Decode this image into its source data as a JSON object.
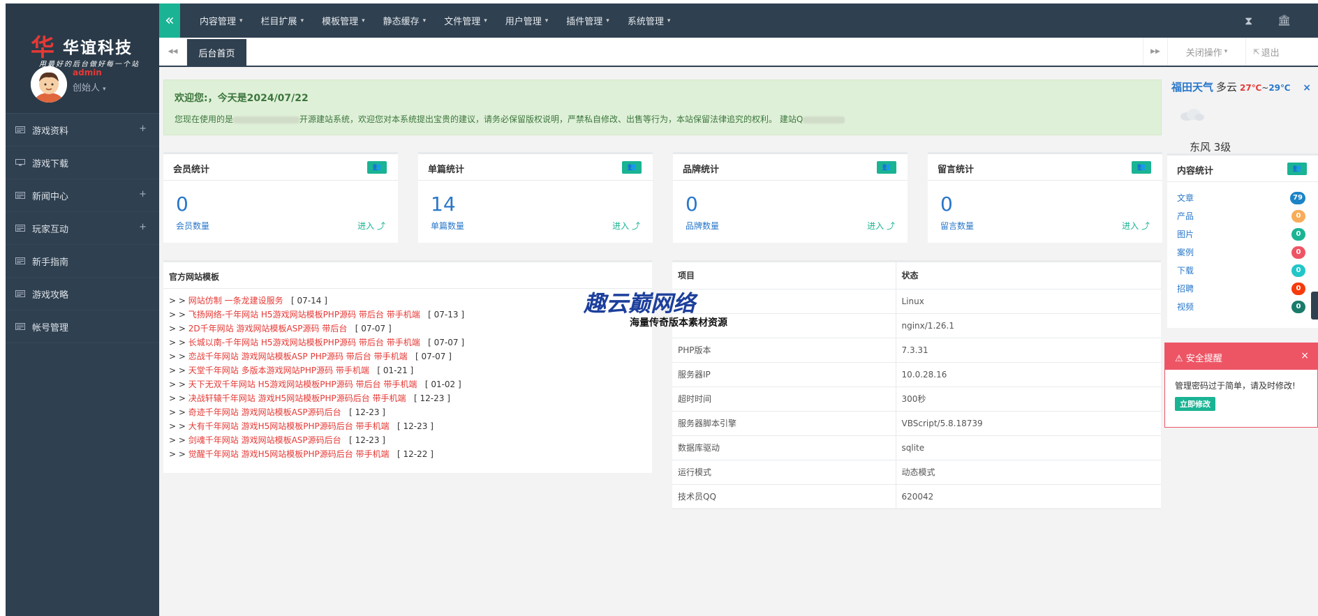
{
  "brand": {
    "mark": "华",
    "name": "华谊科技",
    "slogan": "用最好的后台做好每一个站"
  },
  "user": {
    "name": "admin",
    "role": "创始人"
  },
  "sidebar": {
    "items": [
      {
        "label": "游戏资料",
        "expandable": true,
        "icon": "list-icon"
      },
      {
        "label": "游戏下载",
        "expandable": false,
        "icon": "monitor-icon"
      },
      {
        "label": "新闻中心",
        "expandable": true,
        "icon": "list-icon"
      },
      {
        "label": "玩家互动",
        "expandable": true,
        "icon": "list-icon"
      },
      {
        "label": "新手指南",
        "expandable": false,
        "icon": "list-icon"
      },
      {
        "label": "游戏攻略",
        "expandable": false,
        "icon": "list-icon"
      },
      {
        "label": "帐号管理",
        "expandable": false,
        "icon": "list-icon"
      }
    ],
    "plus": "+"
  },
  "topnav": {
    "collapse_icon": "«",
    "menus": [
      "内容管理",
      "栏目扩展",
      "模板管理",
      "静态缓存",
      "文件管理",
      "用户管理",
      "插件管理",
      "系统管理"
    ],
    "caret": "▾",
    "hourglass": "⧗",
    "bank": "🏛"
  },
  "tabbar": {
    "back": "◀◀",
    "active": "后台首页",
    "forward": "▶▶",
    "close_ops": "关闭操作",
    "logout": "退出"
  },
  "welcome": {
    "title": "欢迎您:，今天是2024/07/22",
    "text_a": "您现在使用的是",
    "text_b": "开源建站系统，欢迎您对本系统提出宝贵的建议，请务必保留版权说明，严禁私自修改、出售等行为，本站保留法律追究的权利。 建站Q"
  },
  "stats": [
    {
      "title": "会员统计",
      "value": "0",
      "label": "会员数量",
      "link": "进入"
    },
    {
      "title": "单篇统计",
      "value": "14",
      "label": "单篇数量",
      "link": "进入"
    },
    {
      "title": "品牌统计",
      "value": "0",
      "label": "品牌数量",
      "link": "进入"
    },
    {
      "title": "留言统计",
      "value": "0",
      "label": "留言数量",
      "link": "进入"
    }
  ],
  "templates": {
    "title": "官方网站模板",
    "items": [
      {
        "name": "网站仿制 一条龙建设服务",
        "date": "[ 07-14 ]"
      },
      {
        "name": "飞扬网络-千年网站 H5游戏网站模板PHP源码 带后台 带手机端",
        "date": "[ 07-13 ]"
      },
      {
        "name": "2D千年网站 游戏网站模板ASP源码 带后台",
        "date": "[ 07-07 ]"
      },
      {
        "name": "长城以南-千年网站 H5游戏网站模板PHP源码 带后台 带手机端",
        "date": "[ 07-07 ]"
      },
      {
        "name": "恋战千年网站 游戏网站模板ASP PHP源码 带后台 带手机端",
        "date": "[ 07-07 ]"
      },
      {
        "name": "天堂千年网站 多版本游戏网站PHP源码 带手机端",
        "date": "[ 01-21 ]"
      },
      {
        "name": "天下无双千年网站 H5游戏网站模板PHP源码 带后台 带手机端",
        "date": "[ 01-02 ]"
      },
      {
        "name": "决战轩辕千年网站 游戏H5网站模板PHP源码后台 带手机端",
        "date": "[ 12-23 ]"
      },
      {
        "name": "奇迹千年网站 游戏网站模板ASP源码后台",
        "date": "[ 12-23 ]"
      },
      {
        "name": "大有千年网站 游戏H5网站模板PHP源码后台 带手机端",
        "date": "[ 12-23 ]"
      },
      {
        "name": "剑魂千年网站 游戏网站模板ASP源码后台",
        "date": "[ 12-23 ]"
      },
      {
        "name": "觉醒千年网站 游戏H5网站模板PHP源码后台 带手机端",
        "date": "[ 12-22 ]"
      }
    ],
    "prefix": "> >"
  },
  "system": {
    "col1": "项目",
    "col2": "状态",
    "rows": [
      {
        "k": "",
        "v": "Linux"
      },
      {
        "k": "",
        "v": "nginx/1.26.1"
      },
      {
        "k": "PHP版本",
        "v": "7.3.31"
      },
      {
        "k": "服务器IP",
        "v": "10.0.28.16"
      },
      {
        "k": "超时时间",
        "v": "300秒"
      },
      {
        "k": "服务器脚本引擎",
        "v": "VBScript/5.8.18739"
      },
      {
        "k": "数据库驱动",
        "v": "sqlite"
      },
      {
        "k": "运行模式",
        "v": "动态模式"
      },
      {
        "k": "技术员QQ",
        "v": "620042"
      }
    ]
  },
  "watermark": {
    "big": "趣云巅网络",
    "small": "海量传奇版本素材资源"
  },
  "weather": {
    "city": "福田天气",
    "desc": "多云",
    "high": "27℃",
    "sep": "~",
    "low": "29℃",
    "close": "×",
    "wind": "东风 3级"
  },
  "content_stats": {
    "title": "内容统计",
    "items": [
      {
        "label": "文章",
        "value": "79",
        "color": "#1c84c6"
      },
      {
        "label": "产品",
        "value": "0",
        "color": "#f8ac59"
      },
      {
        "label": "图片",
        "value": "0",
        "color": "#1ab394"
      },
      {
        "label": "案例",
        "value": "0",
        "color": "#ed5565"
      },
      {
        "label": "下载",
        "value": "0",
        "color": "#23c6c8"
      },
      {
        "label": "招聘",
        "value": "0",
        "color": "#f73a0b"
      },
      {
        "label": "视频",
        "value": "0",
        "color": "#1a7b6b"
      }
    ]
  },
  "alert": {
    "title": "安全提醒",
    "close": "×",
    "text": "管理密码过于简单，请及时修改!",
    "button": "立即修改"
  },
  "colors": {
    "sidebar": "#2f4050",
    "accent": "#1ab394",
    "danger": "#ed5565",
    "link": "#2977c9"
  }
}
